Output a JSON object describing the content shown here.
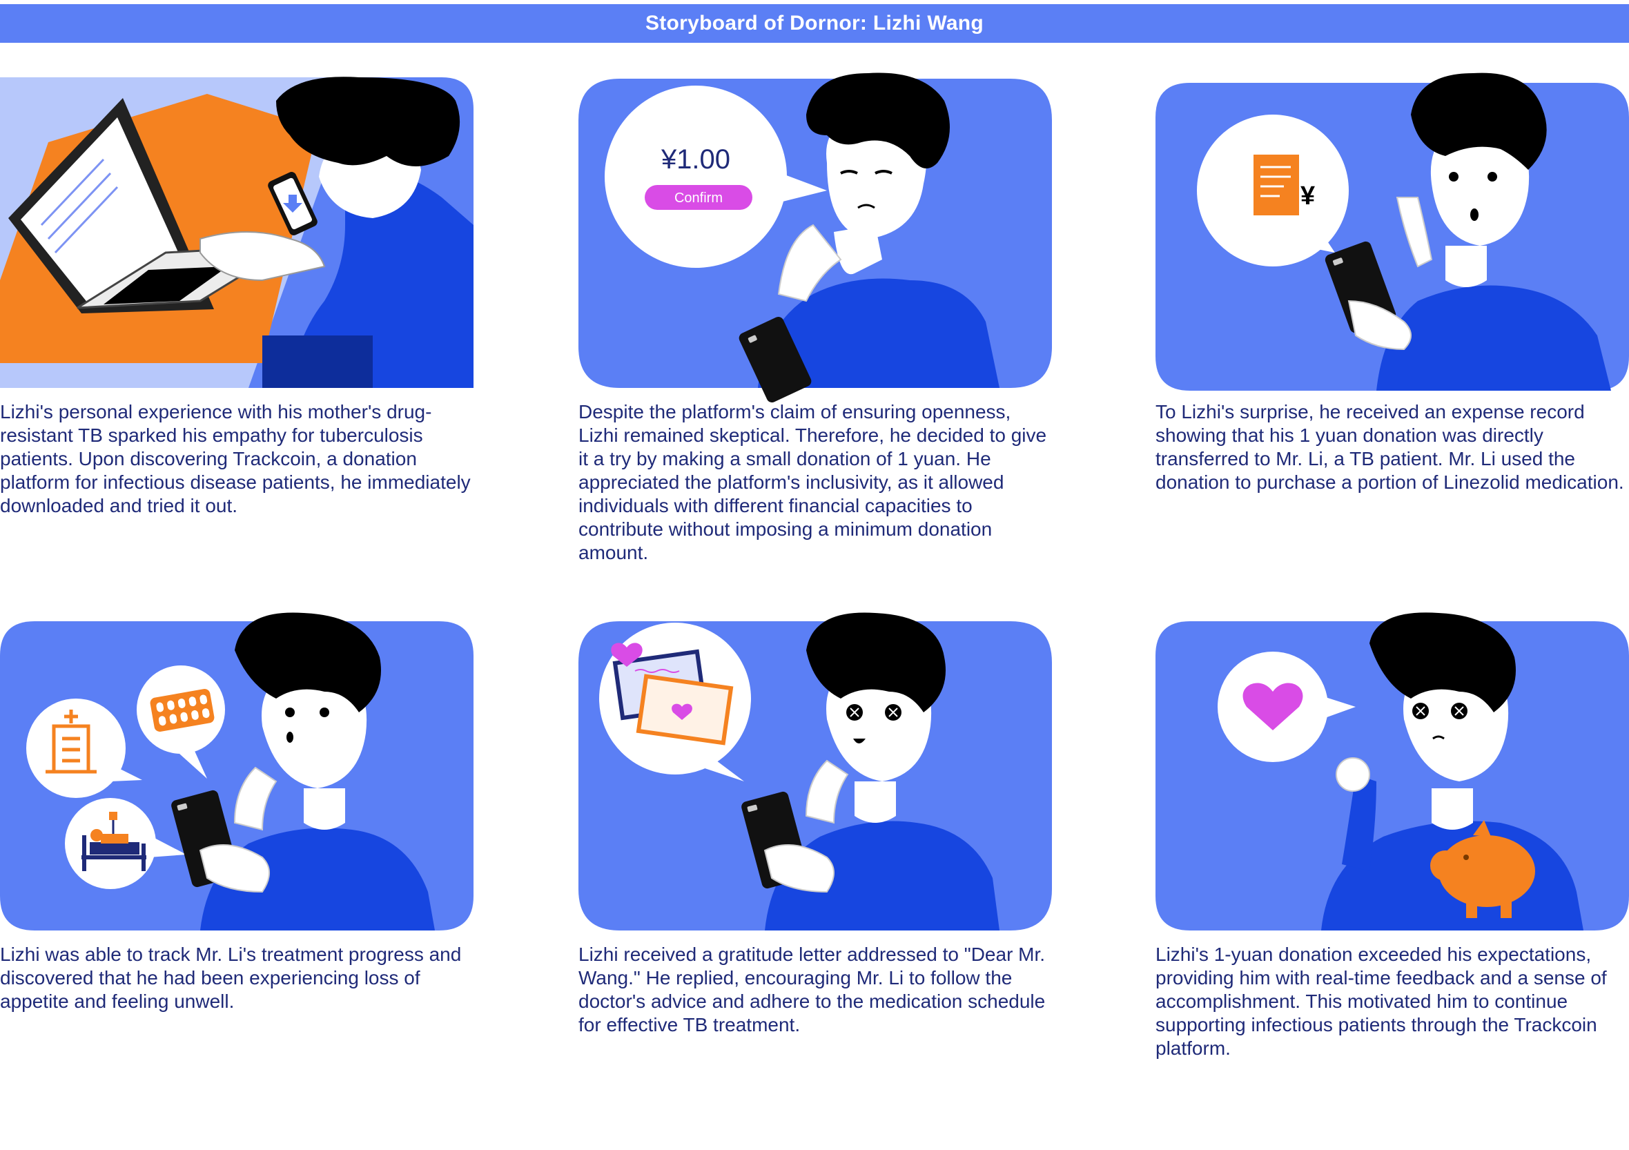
{
  "header": {
    "title": "Storyboard of Dornor: Lizhi Wang"
  },
  "colors": {
    "title_bar": "#5b7ff5",
    "panel_bg": "#5b7ff5",
    "shirt": "#1746e0",
    "hair": "#000000",
    "accent_orange": "#f58220",
    "accent_magenta": "#d94ce6",
    "text": "#1f2a78"
  },
  "panels": [
    {
      "caption": "Lizhi's personal experience with his mother's drug-resistant TB sparked his empathy for tuberculosis patients. Upon discovering Trackcoin, a donation platform for infectious disease patients, he immediately downloaded and tried it out.",
      "icons": [
        "laptop-icon",
        "phone-icon",
        "download-icon"
      ]
    },
    {
      "caption": "Despite the platform's claim of ensuring openness, Lizhi remained skeptical. Therefore, he decided to give it a try by making a small donation of 1 yuan. He appreciated the platform's inclusivity, as it allowed individuals with different financial capacities to contribute without imposing a minimum donation amount.",
      "bubble_amount": "¥1.00",
      "bubble_button": "Confirm",
      "icons": [
        "phone-icon"
      ]
    },
    {
      "caption": "To Lizhi's surprise, he received an expense record showing that his 1 yuan donation was directly transferred to Mr. Li, a TB patient. Mr. Li used the donation to purchase a portion of Linezolid medication.",
      "bubble_glyph": "¥",
      "icons": [
        "receipt-icon",
        "phone-icon"
      ]
    },
    {
      "caption": "Lizhi was able to track Mr. Li's treatment progress and discovered that he had been experiencing loss of appetite and feeling unwell.",
      "icons": [
        "hospital-icon",
        "pill-pack-icon",
        "patient-bed-icon",
        "phone-icon"
      ]
    },
    {
      "caption": "Lizhi received a gratitude letter addressed to \"Dear Mr. Wang.\" He replied, encouraging Mr. Li to follow the doctor's advice and adhere to the medication schedule for effective TB treatment.",
      "icons": [
        "letter-icon",
        "heart-icon",
        "phone-icon"
      ]
    },
    {
      "caption": "Lizhi's 1-yuan donation exceeded his expectations, providing him with real-time feedback and a sense of accomplishment. This motivated him to continue supporting infectious patients through the Trackcoin platform.",
      "icons": [
        "heart-icon",
        "piggy-bank-icon"
      ]
    }
  ]
}
